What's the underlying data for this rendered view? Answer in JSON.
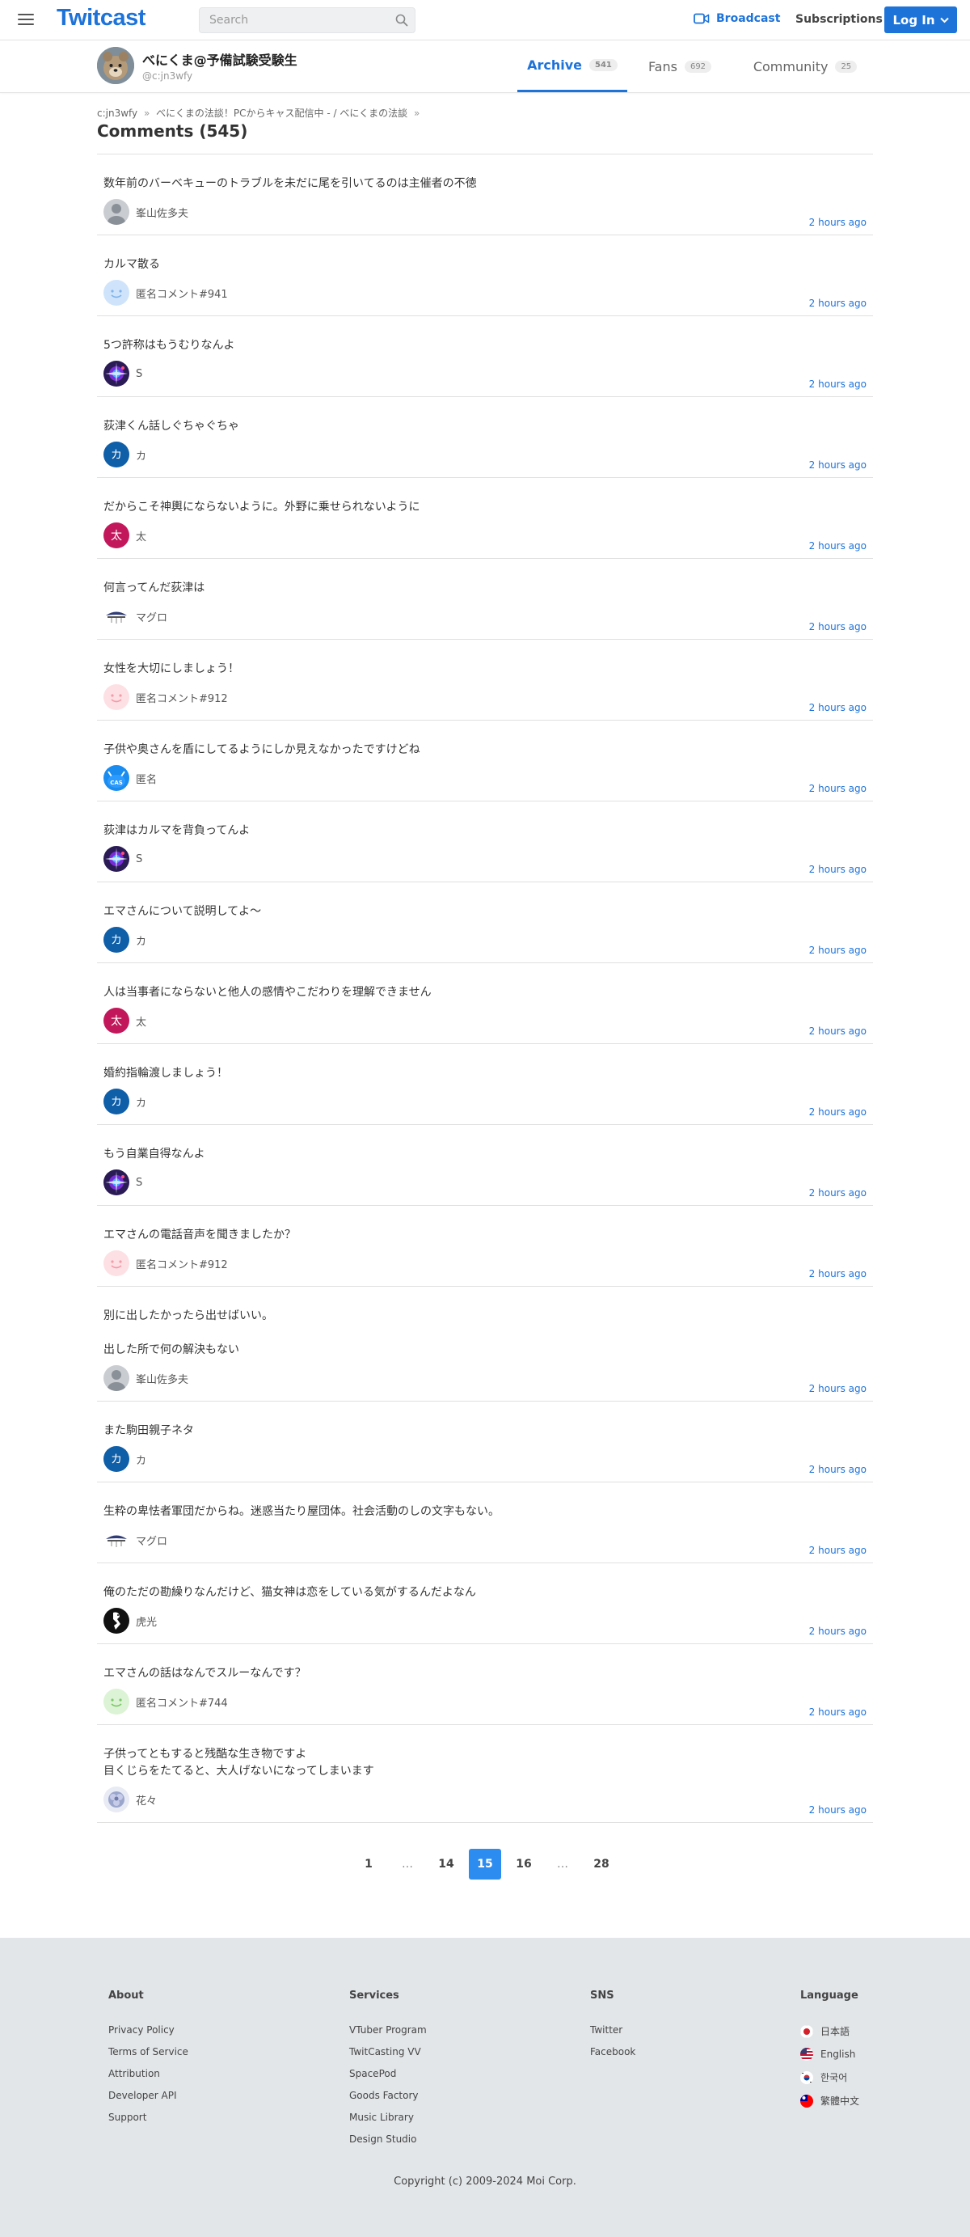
{
  "header": {
    "logo": "Twitcast",
    "search_placeholder": "Search",
    "broadcast_label": "Broadcast",
    "subscriptions_label": "Subscriptions",
    "login_label": "Log In",
    "brand_color": "#1e73d9"
  },
  "profile": {
    "name": "べにくま@予備試験受験生",
    "handle": "@c:jn3wfy",
    "tabs": [
      {
        "label": "Archive",
        "count": "541",
        "active": true
      },
      {
        "label": "Fans",
        "count": "692",
        "active": false
      },
      {
        "label": "Community",
        "count": "25",
        "active": false
      }
    ]
  },
  "breadcrumb": {
    "items": [
      "c:jn3wfy",
      "べにくまの法談！PCからキャス配信中 - / べにくまの法談"
    ],
    "trailing_sep": "»"
  },
  "page_title": "Comments (545)",
  "comments": [
    {
      "text": "数年前のバーベキューのトラブルを未だに尾を引いてるのは主催者の不徳",
      "author": "峯山佐多夫",
      "time": "2 hours ago",
      "avatar": "default"
    },
    {
      "text": "カルマ散る",
      "author": "匿名コメント#941",
      "time": "2 hours ago",
      "avatar": "face-blue"
    },
    {
      "text": "5つ許称はもうむりなんよ",
      "author": "S",
      "time": "2 hours ago",
      "avatar": "burst"
    },
    {
      "text": "荻津くん話しぐちゃぐちゃ",
      "author": "カ",
      "time": "2 hours ago",
      "avatar": "letter-ka"
    },
    {
      "text": "だからこそ神輿にならないように。外野に乗せられないように",
      "author": "太",
      "time": "2 hours ago",
      "avatar": "letter-ta"
    },
    {
      "text": "何言ってんだ荻津は",
      "author": "マグロ",
      "time": "2 hours ago",
      "avatar": "tuna"
    },
    {
      "text": "女性を大切にしましょう！",
      "author": "匿名コメント#912",
      "time": "2 hours ago",
      "avatar": "face-pink"
    },
    {
      "text": "子供や奥さんを盾にしてるようにしか見えなかったですけどね",
      "author": "匿名",
      "time": "2 hours ago",
      "avatar": "cas"
    },
    {
      "text": "荻津はカルマを背負ってんよ",
      "author": "S",
      "time": "2 hours ago",
      "avatar": "burst"
    },
    {
      "text": "エマさんについて説明してよ〜",
      "author": "カ",
      "time": "2 hours ago",
      "avatar": "letter-ka"
    },
    {
      "text": "人は当事者にならないと他人の感情やこだわりを理解できません",
      "author": "太",
      "time": "2 hours ago",
      "avatar": "letter-ta"
    },
    {
      "text": "婚約指輪渡しましょう！",
      "author": "カ",
      "time": "2 hours ago",
      "avatar": "letter-ka"
    },
    {
      "text": "もう自業自得なんよ",
      "author": "S",
      "time": "2 hours ago",
      "avatar": "burst"
    },
    {
      "text": "エマさんの電話音声を聞きましたか？",
      "author": "匿名コメント#912",
      "time": "2 hours ago",
      "avatar": "face-pink"
    },
    {
      "text": "別に出したかったら出せばいい。\n\n出した所で何の解決もない",
      "author": "峯山佐多夫",
      "time": "2 hours ago",
      "avatar": "default"
    },
    {
      "text": "また駒田親子ネタ",
      "author": "カ",
      "time": "2 hours ago",
      "avatar": "letter-ka"
    },
    {
      "text": "生粋の卑怯者軍団だからね。迷惑当たり屋団体。社会活動のしの文字もない。",
      "author": "マグロ",
      "time": "2 hours ago",
      "avatar": "tuna"
    },
    {
      "text": "俺のただの勘繰りなんだけど、猫女神は恋をしている気がするんだよなん",
      "author": "虎光",
      "time": "2 hours ago",
      "avatar": "tiger"
    },
    {
      "text": "エマさんの話はなんでスルーなんです？",
      "author": "匿名コメント#744",
      "time": "2 hours ago",
      "avatar": "face-green"
    },
    {
      "text": "子供ってともすると残酷な生き物ですよ\n目くじらをたてると、大人げないになってしまいます",
      "author": "花々",
      "time": "2 hours ago",
      "avatar": "flower"
    }
  ],
  "pagination": {
    "pages": [
      "1",
      "…",
      "14",
      "15",
      "16",
      "…",
      "28"
    ],
    "current": "15"
  },
  "footer": {
    "columns": [
      {
        "title": "About",
        "links": [
          "Privacy Policy",
          "Terms of Service",
          "Attribution",
          "Developer API",
          "Support"
        ]
      },
      {
        "title": "Services",
        "links": [
          "VTuber Program",
          "TwitCasting VV",
          "SpacePod",
          "Goods Factory",
          "Music Library",
          "Design Studio"
        ]
      },
      {
        "title": "SNS",
        "links": [
          "Twitter",
          "Facebook"
        ]
      },
      {
        "title": "Language",
        "links": [
          "日本語",
          "English",
          "한국어",
          "繁體中文"
        ]
      }
    ],
    "copyright": "Copyright (c) 2009-2024 Moi Corp."
  }
}
